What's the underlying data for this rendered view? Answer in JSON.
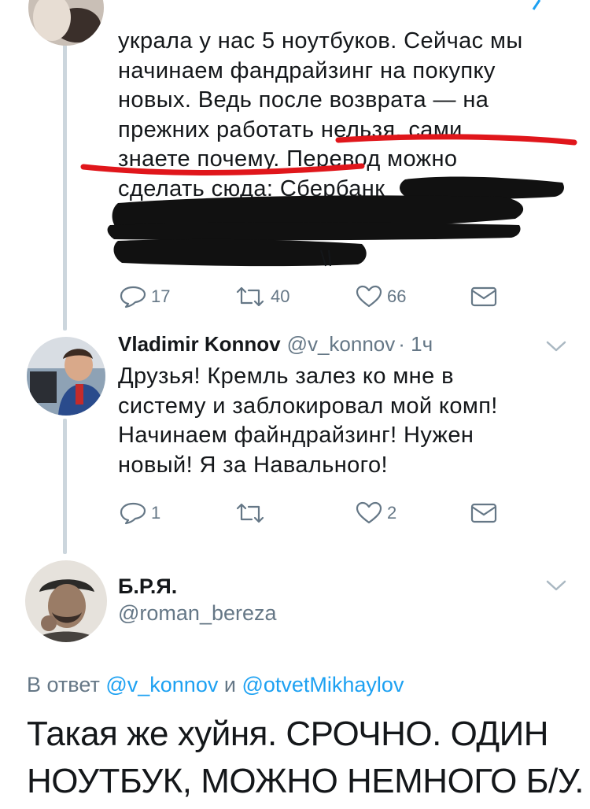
{
  "tweet1": {
    "text_lines": [
      "украла у нас 5 ноутбуков. Сейчас мы",
      "начинаем фандрайзинг на покупку",
      "новых. Ведь после возврата — на",
      "прежних работать нельзя, сами",
      "знаете почему. Перевод можно",
      "сделать сюда: Сбербанк"
    ],
    "replies": "17",
    "retweets": "40",
    "likes": "66"
  },
  "tweet2": {
    "name": "Vladimir Konnov",
    "handle": "@v_konnov",
    "time": "· 1ч",
    "text_lines": [
      "Друзья! Кремль залез ко мне в",
      "систему и заблокировал мой комп!",
      "Начинаем файндрайзинг! Нужен",
      "новый! Я за Навального!"
    ],
    "replies": "1",
    "likes": "2"
  },
  "tweet3": {
    "name": "Б.Р.Я.",
    "handle": "@roman_bereza",
    "reply_prefix": "В ответ",
    "reply_user1": "@v_konnov",
    "reply_and": "и",
    "reply_user2": "@otvetMikhaylov",
    "text_lines": [
      "Такая же хуйня.  СРОЧНО. ОДИН",
      "НОУТБУК, МОЖНО НЕМНОГО Б/У."
    ]
  },
  "colors": {
    "text": "#14171a",
    "muted": "#657786",
    "link": "#1da1f2",
    "thread_line": "#ccd6dd",
    "red_underline": "#e0161b",
    "redaction": "#111111"
  },
  "icons": {
    "reply": "reply-icon",
    "retweet": "retweet-icon",
    "like": "heart-icon",
    "dm": "envelope-icon",
    "more": "chevron-down-icon"
  }
}
